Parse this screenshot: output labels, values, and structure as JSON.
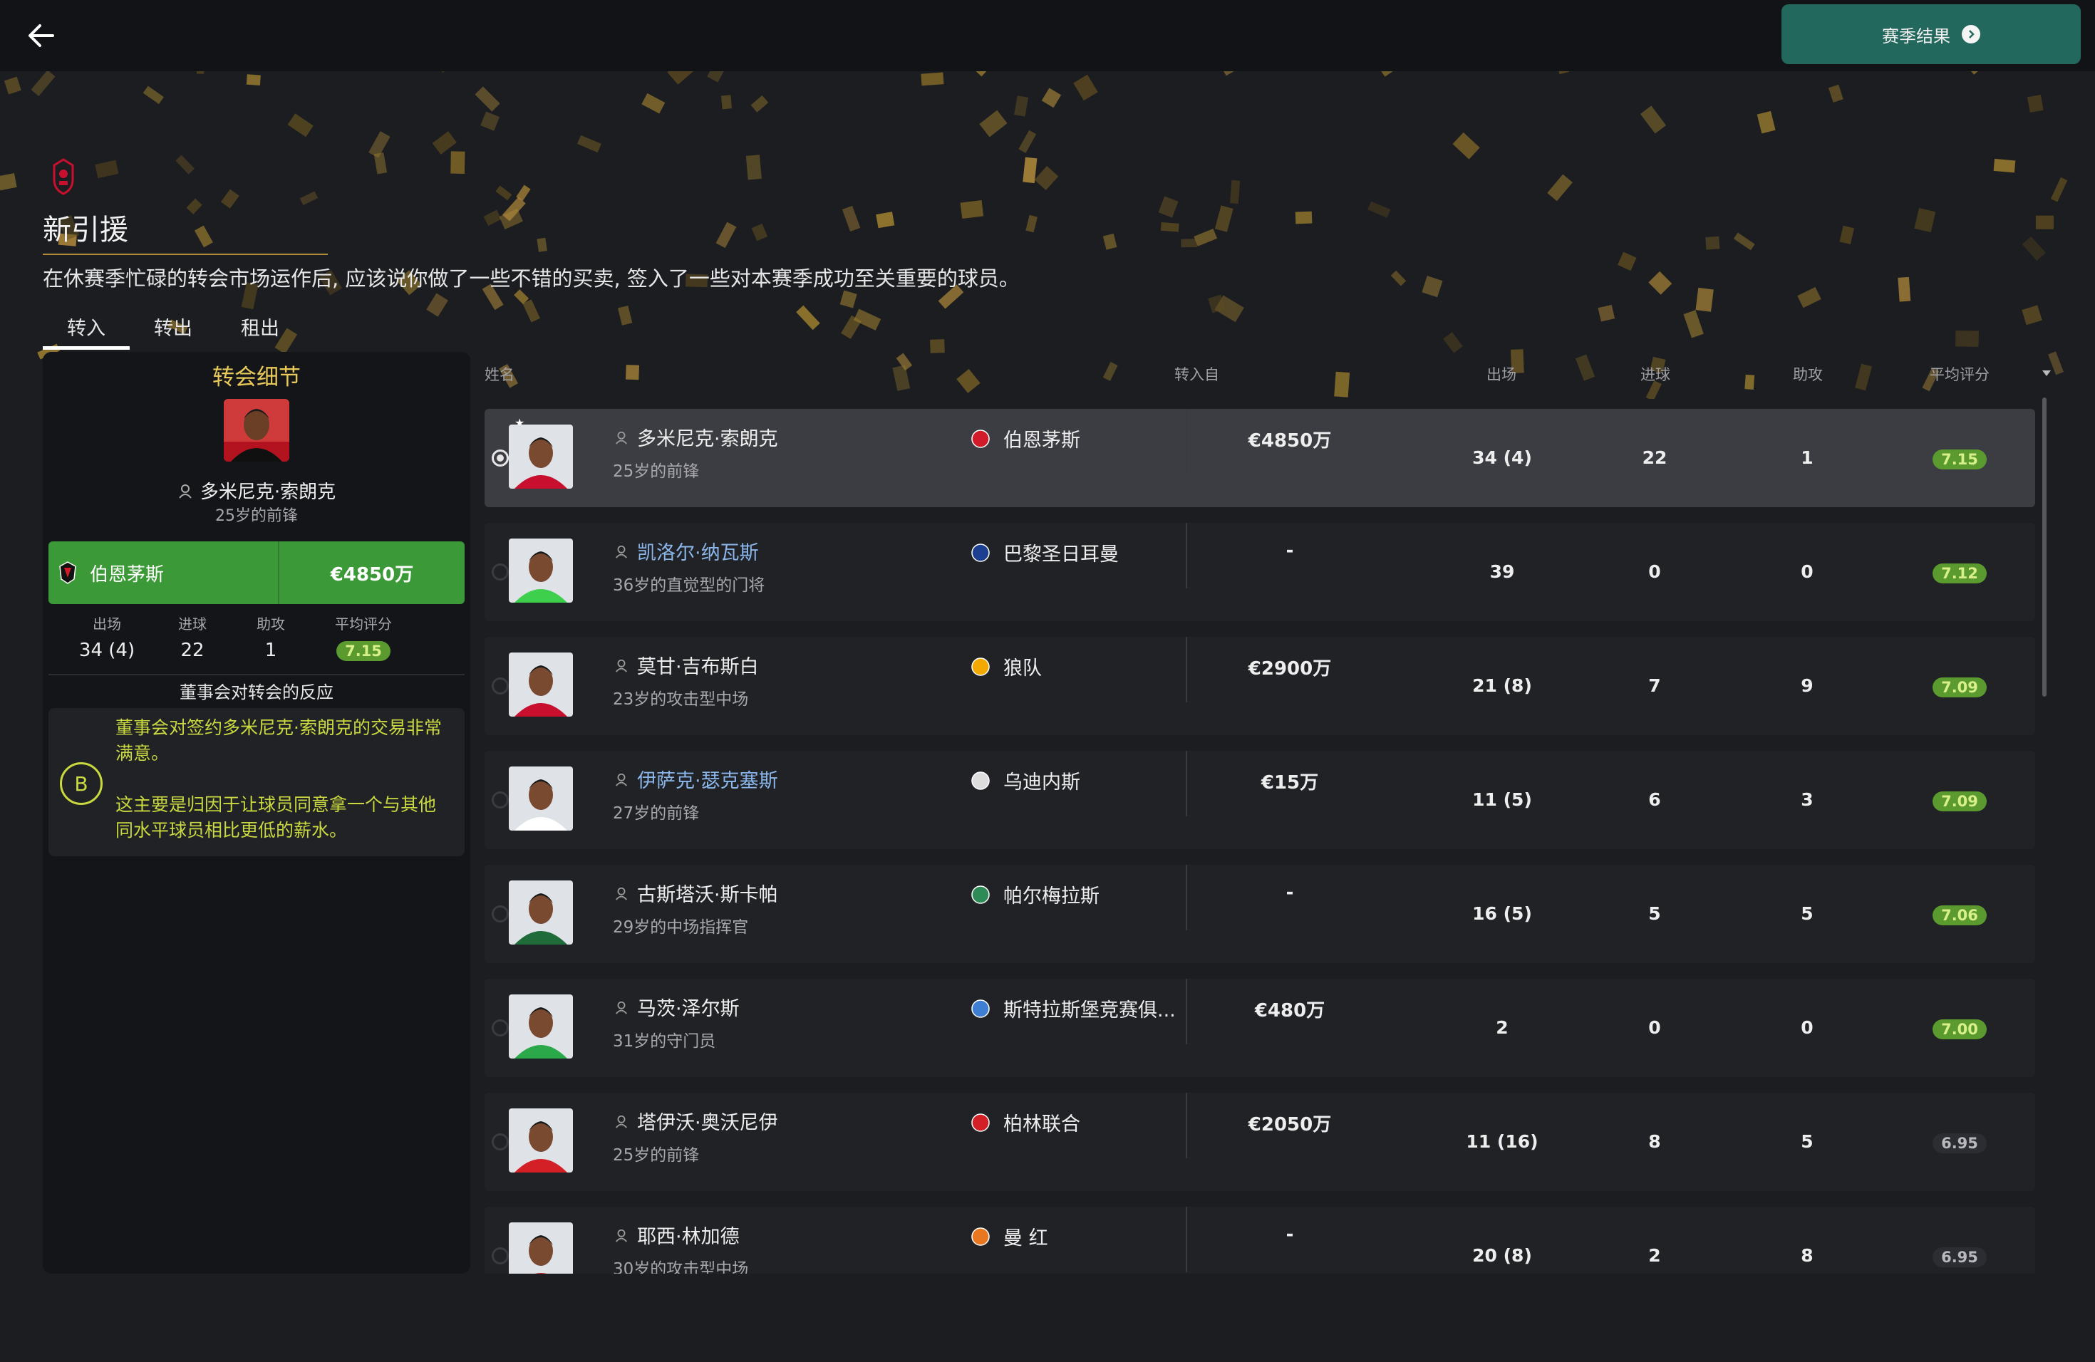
{
  "header": {
    "season_results_label": "赛季结果"
  },
  "page": {
    "title": "新引援",
    "subtitle": "在休赛季忙碌的转会市场运作后, 应该说你做了一些不错的买卖, 签入了一些对本赛季成功至关重要的球员。",
    "tabs": [
      {
        "label": "转入"
      },
      {
        "label": "转出"
      },
      {
        "label": "租出"
      }
    ]
  },
  "detail": {
    "title": "转会细节",
    "name": "多米尼克·索朗克",
    "role": "25岁的前锋",
    "club": "伯恩茅斯",
    "fee": "€4850万",
    "stat_headers": [
      "出场",
      "进球",
      "助攻",
      "平均评分"
    ],
    "stats": {
      "apps": "34 (4)",
      "goals": "22",
      "assists": "1",
      "rating": "7.15"
    },
    "reaction_header": "董事会对转会的反应",
    "grade": "B",
    "reaction_lines": [
      "董事会对签约多米尼克·索朗克的交易非常满意。",
      "这主要是归因于让球员同意拿一个与其他同水平球员相比更低的薪水。"
    ]
  },
  "table": {
    "headers": {
      "name": "姓名",
      "from": "转入自",
      "apps": "出场",
      "goals": "进球",
      "assists": "助攻",
      "rating": "平均评分"
    },
    "rows": [
      {
        "name": "多米尼克·索朗克",
        "role": "25岁的前锋",
        "club": "伯恩茅斯",
        "fee": "€4850万",
        "apps": "34 (4)",
        "goals": "22",
        "assists": "1",
        "rating": "7.15",
        "rating_level": "good",
        "selected": true,
        "link": false,
        "shirt": "#c8102e",
        "crest": "#d11a2a"
      },
      {
        "name": "凯洛尔·纳瓦斯",
        "role": "36岁的直觉型的门将",
        "club": "巴黎圣日耳曼",
        "fee": "-",
        "apps": "39",
        "goals": "0",
        "assists": "0",
        "rating": "7.12",
        "rating_level": "good",
        "selected": false,
        "link": true,
        "shirt": "#3ecf4c",
        "crest": "#1d3f8f"
      },
      {
        "name": "莫甘·吉布斯白",
        "role": "23岁的攻击型中场",
        "club": "狼队",
        "fee": "€2900万",
        "apps": "21 (8)",
        "goals": "7",
        "assists": "9",
        "rating": "7.09",
        "rating_level": "good",
        "selected": false,
        "link": false,
        "shirt": "#c8102e",
        "crest": "#f2a900"
      },
      {
        "name": "伊萨克·瑟克塞斯",
        "role": "27岁的前锋",
        "club": "乌迪内斯",
        "fee": "€15万",
        "apps": "11 (5)",
        "goals": "6",
        "assists": "3",
        "rating": "7.09",
        "rating_level": "good",
        "selected": false,
        "link": true,
        "shirt": "#ffffff",
        "crest": "#dddddd"
      },
      {
        "name": "古斯塔沃·斯卡帕",
        "role": "29岁的中场指挥官",
        "club": "帕尔梅拉斯",
        "fee": "-",
        "apps": "16 (5)",
        "goals": "5",
        "assists": "5",
        "rating": "7.06",
        "rating_level": "good",
        "selected": false,
        "link": false,
        "shirt": "#1f6b3a",
        "crest": "#2e8b57"
      },
      {
        "name": "马茨·泽尔斯",
        "role": "31岁的守门员",
        "club": "斯特拉斯堡竞赛俱...",
        "fee": "€480万",
        "apps": "2",
        "goals": "0",
        "assists": "0",
        "rating": "7.00",
        "rating_level": "good",
        "selected": false,
        "link": false,
        "shirt": "#2aa84a",
        "crest": "#3f7fd1"
      },
      {
        "name": "塔伊沃·奥沃尼伊",
        "role": "25岁的前锋",
        "club": "柏林联合",
        "fee": "€2050万",
        "apps": "11 (16)",
        "goals": "8",
        "assists": "5",
        "rating": "6.95",
        "rating_level": "mid",
        "selected": false,
        "link": false,
        "shirt": "#d31f26",
        "crest": "#d31f26"
      },
      {
        "name": "耶西·林加德",
        "role": "30岁的攻击型中场",
        "club": "曼 红",
        "fee": "-",
        "apps": "20 (8)",
        "goals": "2",
        "assists": "8",
        "rating": "6.95",
        "rating_level": "mid",
        "selected": false,
        "link": false,
        "shirt": "#d31f26",
        "crest": "#e87722"
      }
    ]
  },
  "colors": {
    "accent_green": "#23685d",
    "club_bar": "#3b9a37",
    "rating_good": "#5a9a2e",
    "grade": "#c9d93f",
    "gold": "#b08a3a"
  }
}
